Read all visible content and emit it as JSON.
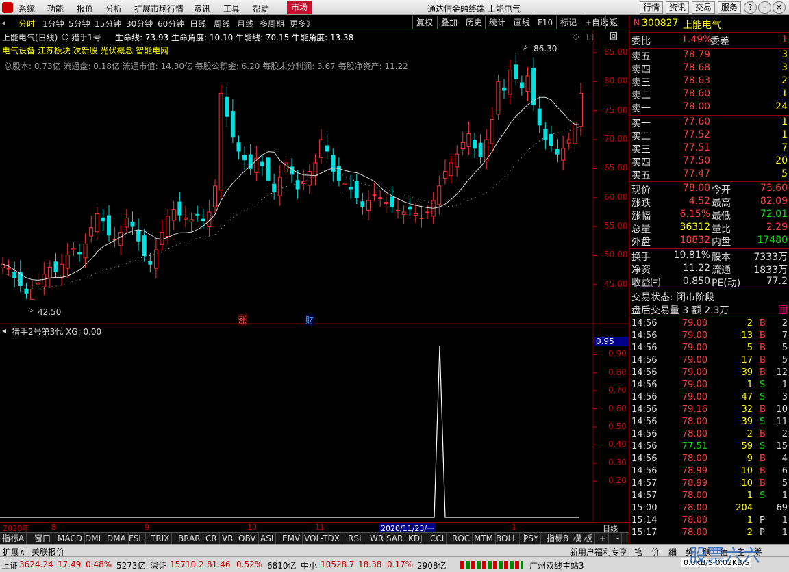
{
  "menubar": {
    "items": [
      "系统",
      "功能",
      "报价",
      "分析",
      "扩展市场行情",
      "资讯",
      "工具",
      "帮助"
    ],
    "market": "市场",
    "title": "通达信金融终端 上能电气",
    "right_buttons": [
      "行情",
      "资讯",
      "交易",
      "服务"
    ]
  },
  "periods": {
    "items": [
      "分时",
      "1分钟",
      "5分钟",
      "15分钟",
      "30分钟",
      "60分钟",
      "日线",
      "周线",
      "月线",
      "多周期",
      "更多》"
    ],
    "active": "分时",
    "tools": [
      "复权",
      "叠加",
      "历史",
      "统计",
      "画线",
      "F10",
      "标记",
      "+自选",
      "返回"
    ]
  },
  "chart_header": {
    "stock": "上能电气(日线)",
    "indicator": "猎手1号",
    "vals": "生命线: 73.93  生命角度: 10.10  牛能线: 70.15  牛能角度: 13.38",
    "concepts": "电气设备 江苏板块 次新股 光伏概念 智能电网",
    "fundamentals": "总股本: 0.73亿 流通盘: 0.18亿 流通市值: 14.30亿 每股公积金: 6.20 每股未分利润: 3.67 每股净资产: 11.22",
    "high_label": "86.30",
    "low_label": "42.50",
    "mark_zhang": "涨",
    "mark_cai": "财"
  },
  "price_axis": [
    "85.00",
    "80.00",
    "75.00",
    "70.00",
    "65.00",
    "60.00",
    "55.00",
    "50.00",
    "45.00"
  ],
  "sub_header": "猎手2号第3代  XG: 0.00",
  "sub_axis": [
    "0.90",
    "0.80",
    "0.70",
    "0.60",
    "0.50",
    "0.40",
    "0.30",
    "0.20"
  ],
  "sub_badge": "0.95",
  "time_axis": {
    "labels": [
      "2020年",
      "8",
      "9",
      "10",
      "11",
      "1"
    ],
    "cursor": "2020/11/23/一",
    "daily": "日线"
  },
  "indicators": [
    "指标A",
    "窗口",
    "MACD",
    "DMI",
    "DMA",
    "FSL",
    "TRIX",
    "BRAR",
    "CR",
    "VR",
    "OBV",
    "ASI",
    "EMV",
    "VOL-TDX",
    "RSI",
    "WR",
    "SAR",
    "KDJ",
    "CCI",
    "ROC",
    "MTM",
    "BOLL",
    "PSY",
    "〉",
    "指标B",
    "模 板",
    "+",
    "-"
  ],
  "ext": {
    "left": [
      "扩展∧",
      "关联报价"
    ],
    "right": "新用户福利专享",
    "icons": [
      "笔",
      "价",
      "细",
      "势",
      "联",
      "值",
      "主",
      "筹"
    ]
  },
  "status": [
    {
      "name": "上证",
      "price": "3624.24",
      "chg": "17.49",
      "pct": "0.48%",
      "vol": "5273亿"
    },
    {
      "name": "深证",
      "price": "15710.2",
      "chg": "81.46",
      "pct": "0.52%",
      "vol": "6810亿"
    },
    {
      "name": "中小",
      "price": "10528.7",
      "chg": "18.38",
      "pct": "0.17%",
      "vol": "2908亿"
    }
  ],
  "status_server": "广州双线主站3",
  "status_net": "0.0KB/S 0.02KB/S",
  "watermark": "股票六六",
  "quote": {
    "code": "300827",
    "name": "上能电气",
    "flag": "N",
    "weibi_label": "委比",
    "weibi": "1.49%",
    "weicha_label": "委差",
    "weicha": "1",
    "asks": [
      {
        "label": "卖五",
        "price": "78.79",
        "vol": "3"
      },
      {
        "label": "卖四",
        "price": "78.68",
        "vol": "3"
      },
      {
        "label": "卖三",
        "price": "78.63",
        "vol": "2"
      },
      {
        "label": "卖二",
        "price": "78.60",
        "vol": "1"
      },
      {
        "label": "卖一",
        "price": "78.00",
        "vol": "24"
      }
    ],
    "bids": [
      {
        "label": "买一",
        "price": "77.60",
        "vol": "1"
      },
      {
        "label": "买二",
        "price": "77.52",
        "vol": "1"
      },
      {
        "label": "买三",
        "price": "77.51",
        "vol": "7"
      },
      {
        "label": "买四",
        "price": "77.50",
        "vol": "20"
      },
      {
        "label": "买五",
        "price": "77.47",
        "vol": "5"
      }
    ],
    "stats": [
      {
        "l1": "现价",
        "v1": "78.00",
        "c1": "red",
        "l2": "今开",
        "v2": "73.60",
        "c2": "red"
      },
      {
        "l1": "涨跌",
        "v1": "4.52",
        "c1": "red",
        "l2": "最高",
        "v2": "82.09",
        "c2": "red"
      },
      {
        "l1": "涨幅",
        "v1": "6.15%",
        "c1": "red",
        "l2": "最低",
        "v2": "72.01",
        "c2": "green"
      },
      {
        "l1": "总量",
        "v1": "36312",
        "c1": "yellow",
        "l2": "量比",
        "v2": "2.29",
        "c2": "red"
      },
      {
        "l1": "外盘",
        "v1": "18832",
        "c1": "red",
        "l2": "内盘",
        "v2": "17480",
        "c2": "green"
      }
    ],
    "stats2": [
      {
        "l1": "换手",
        "v1": "19.81%",
        "l2": "股本",
        "v2": "7333万"
      },
      {
        "l1": "净资",
        "v1": "11.22",
        "l2": "流通",
        "v2": "1833万"
      },
      {
        "l1": "收益㈢",
        "v1": "0.850",
        "l2": "PE(动)",
        "v2": "77.2"
      }
    ],
    "trade_state": "交易状态: 闭市阶段",
    "after_hours": "盘后交易量 3 额 2.3万",
    "ticks": [
      [
        "14:56",
        "79.00",
        "2",
        "B",
        "2"
      ],
      [
        "14:56",
        "79.00",
        "13",
        "B",
        "7"
      ],
      [
        "14:56",
        "79.00",
        "5",
        "B",
        "5"
      ],
      [
        "14:56",
        "79.00",
        "17",
        "B",
        "5"
      ],
      [
        "14:56",
        "79.00",
        "39",
        "B",
        "12"
      ],
      [
        "14:56",
        "79.00",
        "1",
        "S",
        "1"
      ],
      [
        "14:56",
        "79.00",
        "47",
        "S",
        "3"
      ],
      [
        "14:56",
        "79.16",
        "32",
        "B",
        "10"
      ],
      [
        "14:56",
        "78.00",
        "39",
        "S",
        "11"
      ],
      [
        "14:56",
        "78.00",
        "2",
        "B",
        "2"
      ],
      [
        "14:56",
        "77.51",
        "59",
        "S",
        "15"
      ],
      [
        "14:56",
        "78.00",
        "9",
        "B",
        "4"
      ],
      [
        "14:56",
        "78.99",
        "10",
        "B",
        "6"
      ],
      [
        "14:57",
        "78.99",
        "10",
        "B",
        "5"
      ],
      [
        "14:57",
        "78.00",
        "1",
        "S",
        "1"
      ],
      [
        "15:00",
        "78.00",
        "204",
        "",
        "69"
      ],
      [
        "15:14",
        "78.00",
        "1",
        "P",
        "1"
      ],
      [
        "15:17",
        "78.00",
        "2",
        "P",
        "1"
      ]
    ]
  },
  "chart_data": {
    "type": "candlestick",
    "price_range": [
      42.5,
      86.3
    ],
    "high": 86.3,
    "low": 42.5,
    "sub_range": [
      0,
      1
    ],
    "sub_spike": 0.95
  }
}
